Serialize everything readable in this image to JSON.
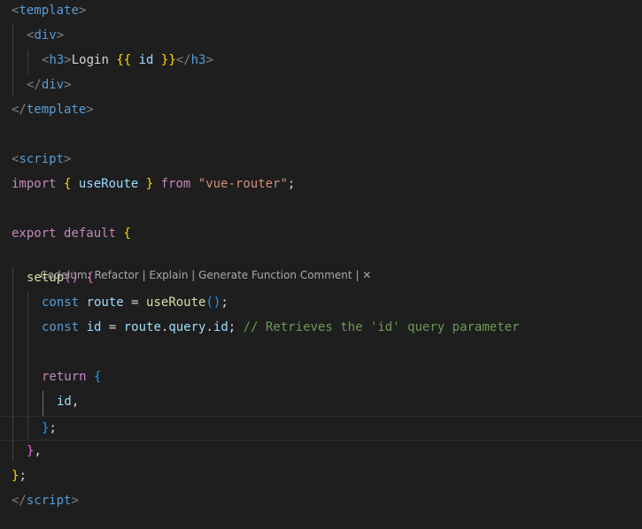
{
  "editor": {
    "codelens": {
      "prefix": "Codeium: ",
      "actions": [
        "Refactor",
        "Explain",
        "Generate Function Comment"
      ],
      "separator": " | ",
      "close": "✕"
    },
    "lines": [
      [
        [
          "<",
          "br"
        ],
        [
          "template",
          "tag"
        ],
        [
          ">",
          "br"
        ]
      ],
      [
        [
          "<",
          "br"
        ],
        [
          "div",
          "tag"
        ],
        [
          ">",
          "br"
        ]
      ],
      [
        [
          "<",
          "br"
        ],
        [
          "h3",
          "tag"
        ],
        [
          ">",
          "br"
        ],
        [
          "Login ",
          "text"
        ],
        [
          "{{",
          "mus"
        ],
        [
          " id ",
          "var"
        ],
        [
          "}}",
          "mus"
        ],
        [
          "</",
          "br"
        ],
        [
          "h3",
          "tag"
        ],
        [
          ">",
          "br"
        ]
      ],
      [
        [
          "</",
          "br"
        ],
        [
          "div",
          "tag"
        ],
        [
          ">",
          "br"
        ]
      ],
      [
        [
          "</",
          "br"
        ],
        [
          "template",
          "tag"
        ],
        [
          ">",
          "br"
        ]
      ],
      [],
      [
        [
          "<",
          "br"
        ],
        [
          "script",
          "tag"
        ],
        [
          ">",
          "br"
        ]
      ],
      [
        [
          "import ",
          "kw"
        ],
        [
          "{",
          "y"
        ],
        [
          " useRoute ",
          "var"
        ],
        [
          "}",
          "y"
        ],
        [
          " from ",
          "kw"
        ],
        [
          "\"vue-router\"",
          "str"
        ],
        [
          ";",
          "punc"
        ]
      ],
      [],
      [
        [
          "export ",
          "kw"
        ],
        [
          "default ",
          "kw"
        ],
        [
          "{",
          "y"
        ]
      ],
      [
        [
          "setup",
          "fn"
        ],
        [
          "()",
          "p"
        ],
        [
          " ",
          "punc"
        ],
        [
          "{",
          "p"
        ]
      ],
      [
        [
          "const ",
          "kwb"
        ],
        [
          "route",
          "var"
        ],
        [
          " = ",
          "punc"
        ],
        [
          "useRoute",
          "fn"
        ],
        [
          "()",
          "b"
        ],
        [
          ";",
          "punc"
        ]
      ],
      [
        [
          "const ",
          "kwb"
        ],
        [
          "id",
          "var"
        ],
        [
          " = ",
          "punc"
        ],
        [
          "route",
          "var"
        ],
        [
          ".",
          "punc"
        ],
        [
          "query",
          "var"
        ],
        [
          ".",
          "punc"
        ],
        [
          "id",
          "var"
        ],
        [
          "; ",
          "punc"
        ],
        [
          "// Retrieves the 'id' query parameter",
          "cmt"
        ]
      ],
      [],
      [
        [
          "return ",
          "kw"
        ],
        [
          "{",
          "b"
        ]
      ],
      [
        [
          "id",
          "var"
        ],
        [
          ",",
          "punc"
        ]
      ],
      [
        [
          "}",
          "b"
        ],
        [
          ";",
          "punc"
        ]
      ],
      [
        [
          "}",
          "p"
        ],
        [
          ",",
          "punc"
        ]
      ],
      [
        [
          "}",
          "y"
        ],
        [
          ";",
          "punc"
        ]
      ],
      [
        [
          "</",
          "br"
        ],
        [
          "script",
          "tag"
        ],
        [
          ">",
          "br"
        ]
      ]
    ]
  }
}
